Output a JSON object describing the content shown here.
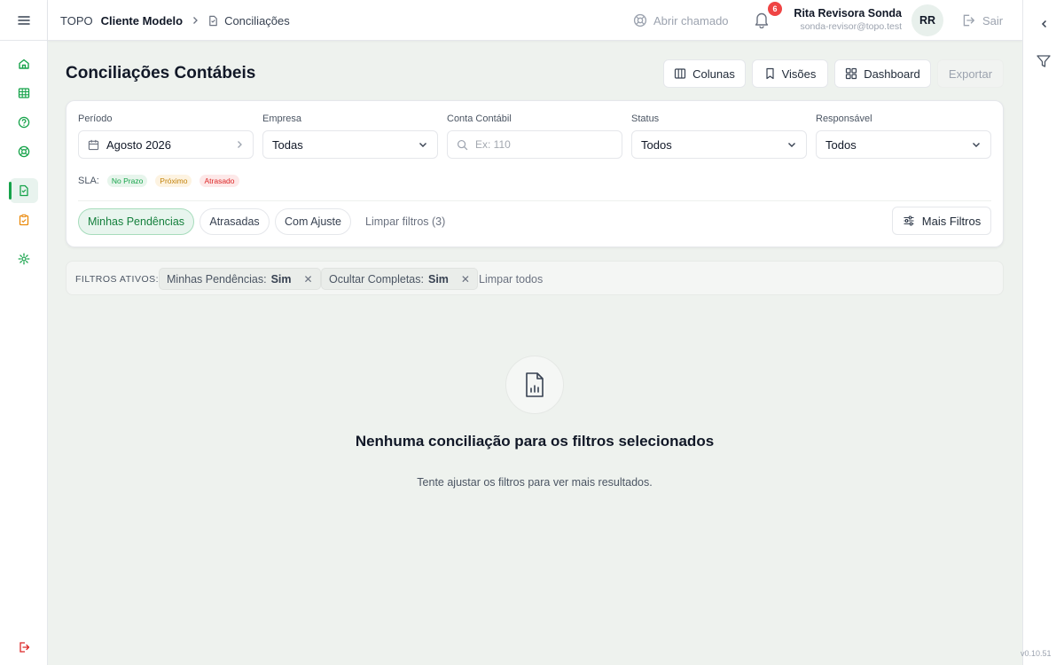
{
  "header": {
    "brand": "TOPO",
    "client": "Cliente Modelo",
    "page": "Conciliações",
    "support_label": "Abrir chamado",
    "notification_count": "6",
    "user_name": "Rita Revisora Sonda",
    "user_email": "sonda-revisor@topo.test",
    "user_initials": "RR",
    "logout_label": "Sair"
  },
  "main": {
    "title": "Conciliações Contábeis",
    "actions": {
      "columns": "Colunas",
      "views": "Visões",
      "dashboard": "Dashboard",
      "export": "Exportar"
    }
  },
  "filters": {
    "period_label": "Período",
    "period_value": "Agosto 2026",
    "company_label": "Empresa",
    "company_value": "Todas",
    "account_label": "Conta Contábil",
    "account_placeholder": "Ex: 110",
    "status_label": "Status",
    "status_value": "Todos",
    "owner_label": "Responsável",
    "owner_value": "Todos",
    "sla_label": "SLA:",
    "sla_items": [
      "No Prazo",
      "Próximo",
      "Atrasado"
    ],
    "quick": [
      "Minhas Pendências",
      "Atrasadas",
      "Com Ajuste"
    ],
    "clear_label": "Limpar filtros (3)",
    "more_label": "Mais Filtros"
  },
  "active_filters": {
    "label": "FILTROS ATIVOS:",
    "tags": [
      {
        "key": "Minhas Pendências:",
        "value": "Sim"
      },
      {
        "key": "Ocultar Completas:",
        "value": "Sim"
      }
    ],
    "clear_all": "Limpar todos"
  },
  "empty_state": {
    "title": "Nenhuma conciliação para os filtros selecionados",
    "subtitle": "Tente ajustar os filtros para ver mais resultados."
  },
  "version": "v0.10.51",
  "colors": {
    "accent": "#16a34a",
    "danger": "#ef4444",
    "warning": "#c2820a"
  },
  "icons": {
    "rail": [
      "menu-icon",
      "home-icon",
      "table-icon",
      "help-icon",
      "lifebuoy-icon",
      "document-icon",
      "clipboard-icon",
      "settings-icon",
      "logout-icon"
    ]
  }
}
